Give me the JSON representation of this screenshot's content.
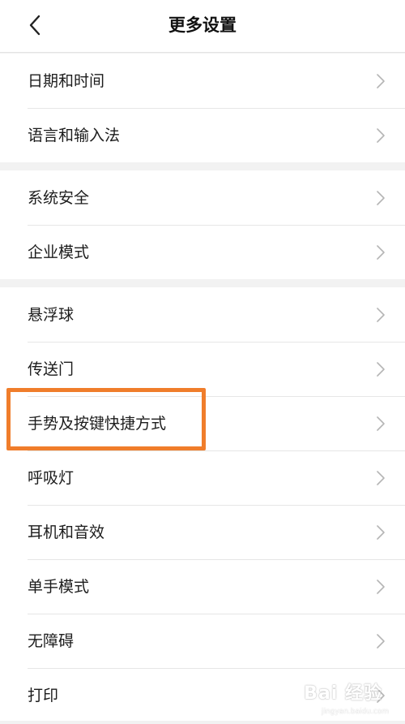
{
  "header": {
    "title": "更多设置"
  },
  "groups": [
    {
      "items": [
        {
          "label": "日期和时间"
        },
        {
          "label": "语言和输入法"
        }
      ]
    },
    {
      "items": [
        {
          "label": "系统安全"
        },
        {
          "label": "企业模式"
        }
      ]
    },
    {
      "items": [
        {
          "label": "悬浮球"
        },
        {
          "label": "传送门"
        },
        {
          "label": "手势及按键快捷方式"
        },
        {
          "label": "呼吸灯"
        },
        {
          "label": "耳机和音效"
        },
        {
          "label": "单手模式"
        },
        {
          "label": "无障碍"
        },
        {
          "label": "打印"
        }
      ]
    }
  ],
  "watermark": {
    "brand": "Bai 经验",
    "url": "jingyan.baidu.com"
  },
  "colors": {
    "highlight": "#f07d2b",
    "background": "#f2f2f2",
    "divider": "#e6e6e6"
  }
}
